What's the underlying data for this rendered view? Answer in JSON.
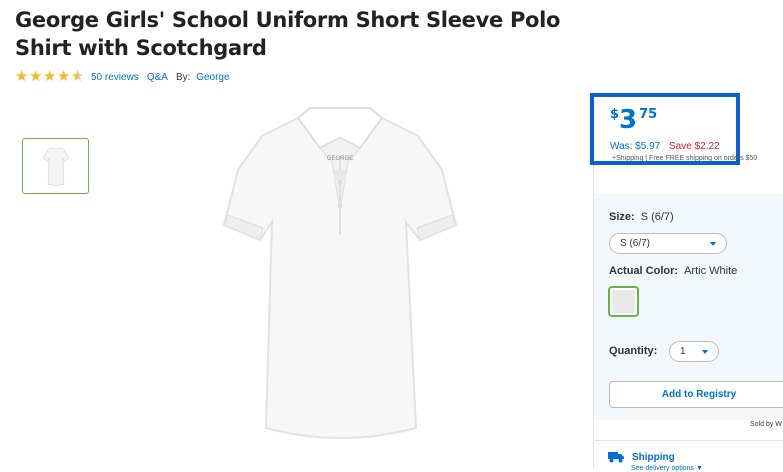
{
  "product": {
    "title": "George Girls' School Uniform Short Sleeve Polo Shirt with Scotchgard",
    "rating": 4.5,
    "reviews_label": "50 reviews",
    "qa_label": "Q&A",
    "by_label": "By:",
    "brand": "George",
    "garment_brand_tag": "GEORGE"
  },
  "pricing": {
    "currency": "$",
    "dollars": "3",
    "cents": "75",
    "was": "Was: $5.97",
    "save": "Save $2.22",
    "shipping_note": "+Shipping | Free FREE shipping on orders $50"
  },
  "options": {
    "size_label": "Size:",
    "size_value": "S (6/7)",
    "size_dropdown": "S (6/7)",
    "color_label": "Actual Color:",
    "color_value": "Artic White",
    "quantity_label": "Quantity:",
    "quantity_value": "1"
  },
  "actions": {
    "add_to_registry": "Add to Registry",
    "sold_by": "Sold by W"
  },
  "shipping": {
    "label": "Shipping",
    "delivery_options": "See delivery options ▼"
  },
  "colors": {
    "link": "#0071ce",
    "star": "#f8b823",
    "save": "#de1c24",
    "highlight": "#0a5fd7",
    "selected": "#6bb241"
  }
}
